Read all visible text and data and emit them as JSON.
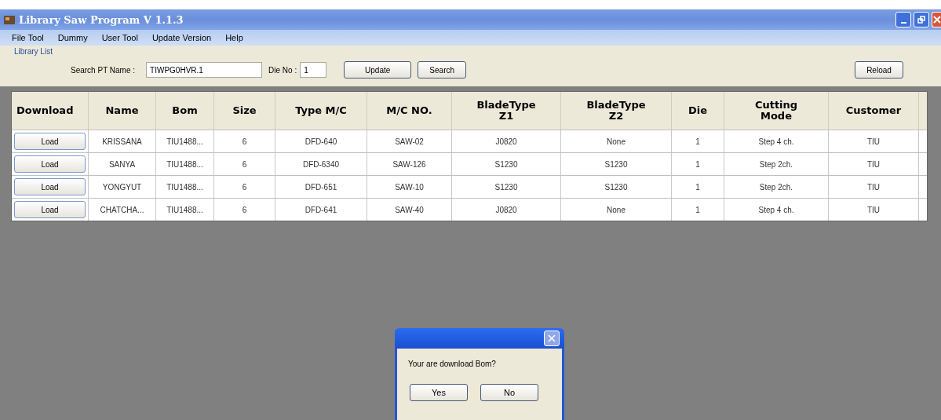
{
  "window": {
    "title": "Library Saw Program V 1.1.3"
  },
  "menu": [
    "File Tool",
    "Dummy",
    "User Tool",
    "Update Version",
    "Help"
  ],
  "group": {
    "title": "Library List",
    "search_label": "Search PT Name :",
    "search_value": "TIWPG0HVR.1",
    "die_label": "Die No :",
    "die_value": "1",
    "buttons": [
      "Update",
      "Search"
    ],
    "reload": "Reload"
  },
  "table": {
    "columns": [
      "Download",
      "Name",
      "Bom",
      "Size",
      "Type M/C",
      "M/C NO.",
      "BladeType\nZ1",
      "BladeType\nZ2",
      "Die",
      "Cutting\nMode",
      "Customer"
    ],
    "rows": [
      {
        "cells": [
          "Load",
          "KRISSANA",
          "TIU1488...",
          "6",
          "DFD-640",
          "SAW-02",
          "J0820",
          "None",
          "1",
          "Step 4 ch.",
          "TIU"
        ]
      },
      {
        "cells": [
          "Load",
          "SANYA",
          "TIU1488...",
          "6",
          "DFD-6340",
          "SAW-126",
          "S1230",
          "S1230",
          "1",
          "Step 2ch.",
          "TIU"
        ]
      },
      {
        "cells": [
          "Load",
          "YONGYUT",
          "TIU1488...",
          "6",
          "DFD-651",
          "SAW-10",
          "S1230",
          "S1230",
          "1",
          "Step 2ch.",
          "TIU"
        ]
      },
      {
        "cells": [
          "Load",
          "CHATCHA...",
          "TIU1488...",
          "6",
          "DFD-641",
          "SAW-40",
          "J0820",
          "None",
          "1",
          "Step 4 ch.",
          "TIU"
        ]
      }
    ]
  },
  "dialog": {
    "message": "Your are download Bom?",
    "buttons": [
      "Yes",
      "No"
    ]
  }
}
